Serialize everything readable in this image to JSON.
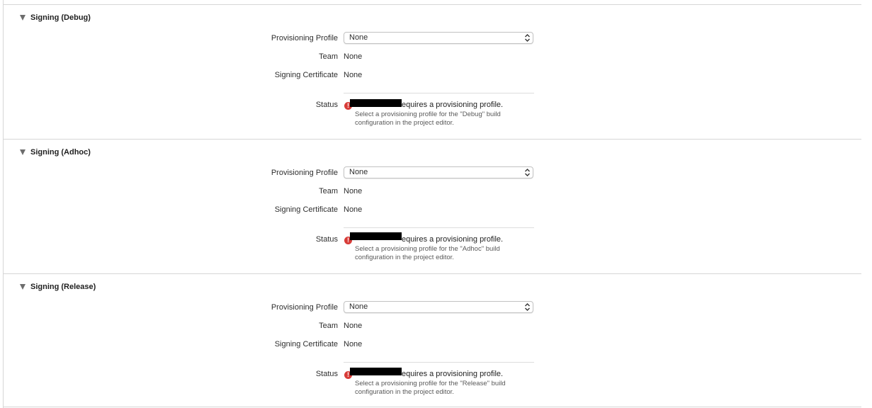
{
  "labels": {
    "provisioning_profile": "Provisioning Profile",
    "team": "Team",
    "signing_certificate": "Signing Certificate",
    "status": "Status"
  },
  "sections": [
    {
      "title": "Signing (Debug)",
      "provisioning_profile": "None",
      "team": "None",
      "signing_certificate": "None",
      "status_message": "equires a provisioning profile.",
      "status_detail_1": "Select a provisioning profile for the \"Debug\" build",
      "status_detail_2": "configuration in the project editor."
    },
    {
      "title": "Signing (Adhoc)",
      "provisioning_profile": "None",
      "team": "None",
      "signing_certificate": "None",
      "status_message": "equires a provisioning profile.",
      "status_detail_1": "Select a provisioning profile for the \"Adhoc\" build",
      "status_detail_2": "configuration in the project editor."
    },
    {
      "title": "Signing (Release)",
      "provisioning_profile": "None",
      "team": "None",
      "signing_certificate": "None",
      "status_message": "equires a provisioning profile.",
      "status_detail_1": "Select a provisioning profile for the \"Release\" build",
      "status_detail_2": "configuration in the project editor."
    }
  ],
  "icons": {
    "disclosure": "disclosure-triangle-down-icon",
    "error": "error-icon",
    "popup": "chevron-up-down-icon"
  },
  "colors": {
    "error": "#d83c38",
    "separator": "#d6d6d6",
    "text": "#2e2e2e",
    "detail_text": "#595959"
  }
}
